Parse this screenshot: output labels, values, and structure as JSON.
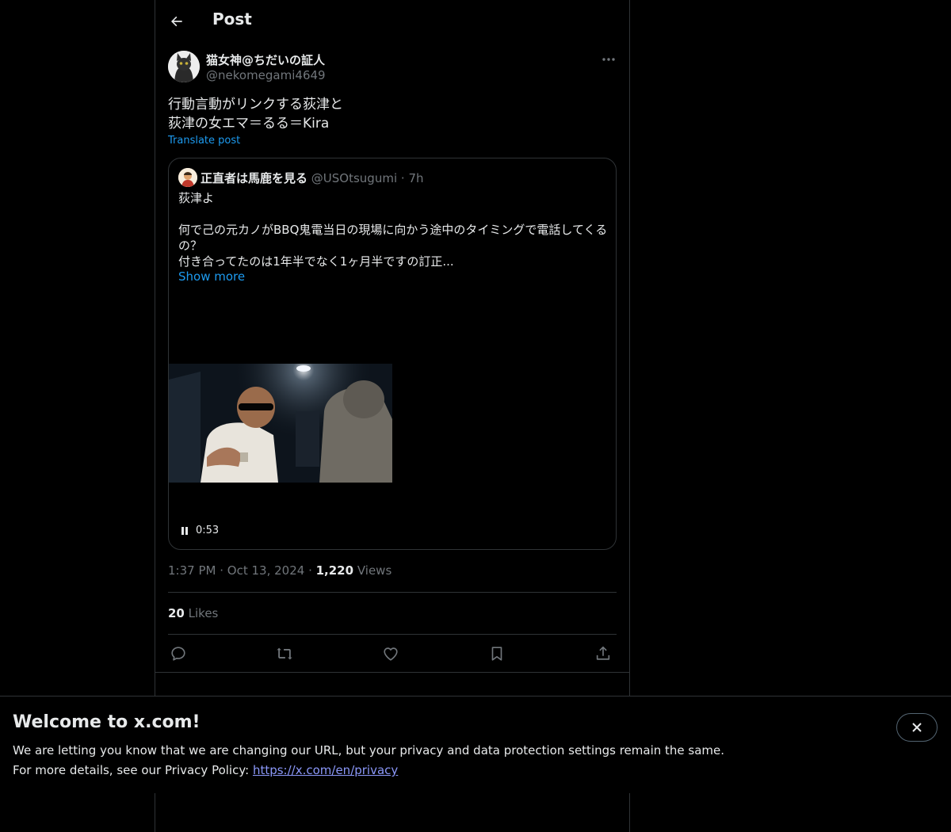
{
  "header": {
    "title": "Post"
  },
  "post": {
    "author_name": "猫女神@ちだいの証人",
    "author_handle": "@nekomegami4649",
    "text": "行動言動がリンクする荻津と\n荻津の女エマ＝るる＝Kira",
    "translate_label": "Translate post",
    "timestamp": "1:37 PM",
    "date": "Oct 13, 2024",
    "views_count": "1,220",
    "views_label": "Views",
    "likes_count": "20",
    "likes_label": "Likes"
  },
  "quote": {
    "author_name": "正直者は馬鹿を見る",
    "author_handle": "@USOtsugumi",
    "time": "7h",
    "text": "荻津よ\n\n何で己の元カノがBBQ鬼電当日の現場に向かう途中のタイミングで電話してくるの？\n付き合ってたのは1年半でなく1ヶ月半ですの訂正...",
    "show_more": "Show more",
    "video_duration": "0:53"
  },
  "banner": {
    "title": "Welcome to x.com!",
    "line1": "We are letting you know that we are changing our URL, but your privacy and data protection settings remain the same.",
    "line2_prefix": "For more details, see our Privacy Policy: ",
    "link_text": "https://x.com/en/privacy"
  },
  "icons": [
    "back-arrow-icon",
    "more-icon",
    "reply-icon",
    "repost-icon",
    "like-icon",
    "bookmark-icon",
    "share-icon",
    "pause-icon",
    "close-icon"
  ],
  "colors": {
    "background": "#000000",
    "text": "#e7e9ea",
    "muted": "#71767b",
    "accent": "#1d9bf0",
    "border": "#2f3336",
    "link": "#8b98f9"
  }
}
